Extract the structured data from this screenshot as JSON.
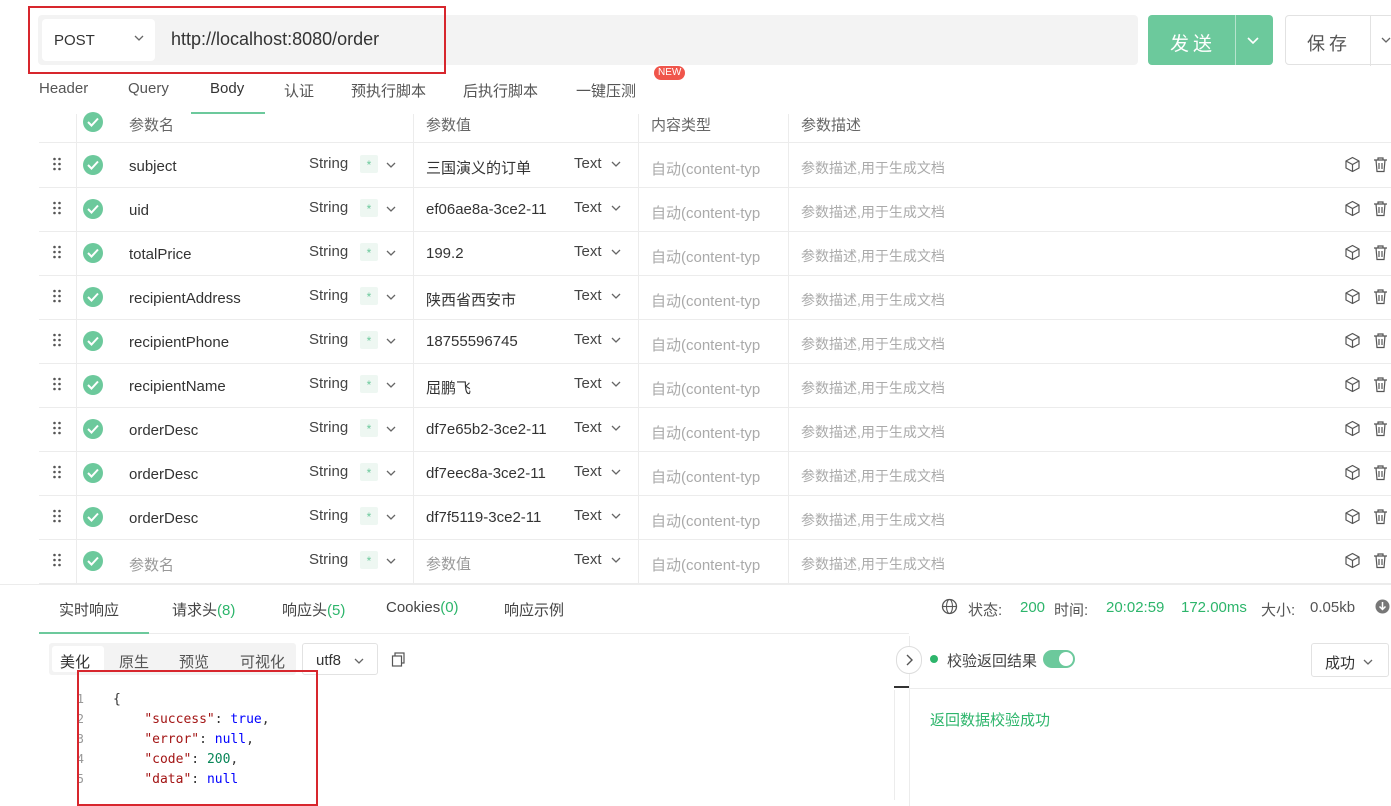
{
  "request": {
    "method": "POST",
    "url": "http://localhost:8080/order",
    "send_label": "发送",
    "save_label": "保存"
  },
  "tabs": [
    {
      "label": "Header"
    },
    {
      "label": "Query"
    },
    {
      "label": "Body"
    },
    {
      "label": "认证"
    },
    {
      "label": "预执行脚本"
    },
    {
      "label": "后执行脚本"
    },
    {
      "label": "一键压测"
    }
  ],
  "new_badge": "NEW",
  "table": {
    "headers": {
      "name": "参数名",
      "value": "参数值",
      "content_type": "内容类型",
      "desc": "参数描述"
    },
    "rows": [
      {
        "name": "subject",
        "type": "String",
        "value": "三国演义的订单",
        "ctype": "Text",
        "cthint": "自动(content-typ",
        "desc": "参数描述,用于生成文档"
      },
      {
        "name": "uid",
        "type": "String",
        "value": "ef06ae8a-3ce2-11",
        "ctype": "Text",
        "cthint": "自动(content-typ",
        "desc": "参数描述,用于生成文档"
      },
      {
        "name": "totalPrice",
        "type": "String",
        "value": "199.2",
        "ctype": "Text",
        "cthint": "自动(content-typ",
        "desc": "参数描述,用于生成文档"
      },
      {
        "name": "recipientAddress",
        "type": "String",
        "value": "陕西省西安市",
        "ctype": "Text",
        "cthint": "自动(content-typ",
        "desc": "参数描述,用于生成文档"
      },
      {
        "name": "recipientPhone",
        "type": "String",
        "value": "18755596745",
        "ctype": "Text",
        "cthint": "自动(content-typ",
        "desc": "参数描述,用于生成文档"
      },
      {
        "name": "recipientName",
        "type": "String",
        "value": "屈鹏飞",
        "ctype": "Text",
        "cthint": "自动(content-typ",
        "desc": "参数描述,用于生成文档"
      },
      {
        "name": "orderDesc",
        "type": "String",
        "value": "df7e65b2-3ce2-11",
        "ctype": "Text",
        "cthint": "自动(content-typ",
        "desc": "参数描述,用于生成文档"
      },
      {
        "name": "orderDesc",
        "type": "String",
        "value": "df7eec8a-3ce2-11",
        "ctype": "Text",
        "cthint": "自动(content-typ",
        "desc": "参数描述,用于生成文档"
      },
      {
        "name": "orderDesc",
        "type": "String",
        "value": "df7f5119-3ce2-11",
        "ctype": "Text",
        "cthint": "自动(content-typ",
        "desc": "参数描述,用于生成文档"
      },
      {
        "name": "参数名",
        "type": "String",
        "value": "参数值",
        "ctype": "Text",
        "cthint": "自动(content-typ",
        "desc": "参数描述,用于生成文档",
        "placeholder": true
      }
    ],
    "required_mark": "*"
  },
  "response": {
    "tabs": [
      {
        "label": "实时响应",
        "count": ""
      },
      {
        "label": "请求头",
        "count": "(8)"
      },
      {
        "label": "响应头",
        "count": "(5)"
      },
      {
        "label": "Cookies",
        "count": "(0)"
      },
      {
        "label": "响应示例",
        "count": ""
      }
    ],
    "status_label": "状态:",
    "status_value": "200",
    "time_label": "时间:",
    "time_value": "20:02:59",
    "duration": "172.00ms",
    "size_label": "大小:",
    "size_value": "0.05kb",
    "formats": [
      "美化",
      "原生",
      "预览",
      "可视化"
    ],
    "encoding": "utf8",
    "code_lines": [
      {
        "n": "1",
        "text": "{"
      },
      {
        "n": "2",
        "key": "\"success\"",
        "val": "true",
        "vt": "b",
        "comma": ","
      },
      {
        "n": "3",
        "key": "\"error\"",
        "val": "null",
        "vt": "b",
        "comma": ","
      },
      {
        "n": "4",
        "key": "\"code\"",
        "val": "200",
        "vt": "n",
        "comma": ","
      },
      {
        "n": "5",
        "key": "\"data\"",
        "val": "null",
        "vt": "b",
        "comma": ""
      }
    ],
    "verify_label": "校验返回结果",
    "verify_result_select": "成功",
    "verify_message": "返回数据校验成功"
  }
}
